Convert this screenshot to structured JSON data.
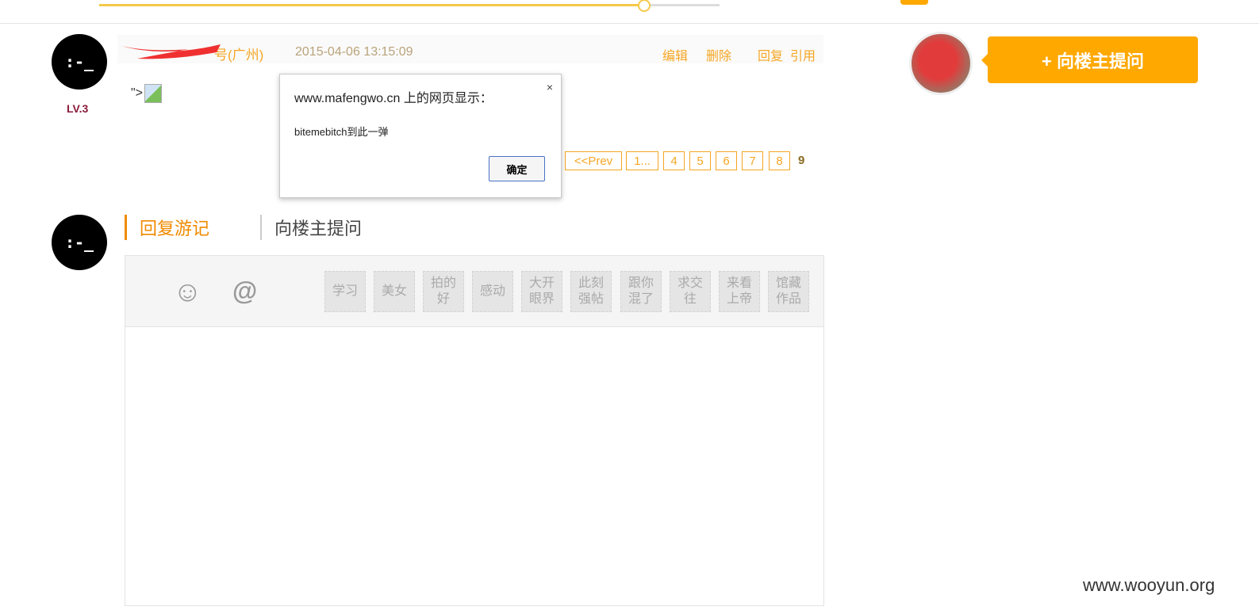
{
  "post": {
    "name": "号(广州)",
    "date": "2015-04-06 13:15:09",
    "level": "LV.3",
    "actions": [
      "编辑",
      "删除",
      "回复",
      "引用"
    ],
    "body_text": "\">"
  },
  "pagination": {
    "prev": "<<Prev",
    "pages": [
      "1...",
      "4",
      "5",
      "6",
      "7",
      "8"
    ],
    "current": "9"
  },
  "dialog": {
    "title": "www.mafengwo.cn 上的网页显示：",
    "close": "×",
    "message": "bitemebitch到此一弹",
    "ok": "确定"
  },
  "reply": {
    "tabs": [
      "回复游记",
      "向楼主提问"
    ],
    "tags": [
      "学习",
      "美女",
      "拍的好",
      "感动",
      "大开眼界",
      "此刻强帖",
      "跟你混了",
      "求交往",
      "来看上帝",
      "馆藏作品"
    ],
    "smiley": "☺",
    "at": "@"
  },
  "sidebar": {
    "ask_button": "+ 向楼主提问"
  },
  "watermark": "www.wooyun.org",
  "colors": {
    "accent": "#ffa800",
    "link": "#f5a623"
  }
}
